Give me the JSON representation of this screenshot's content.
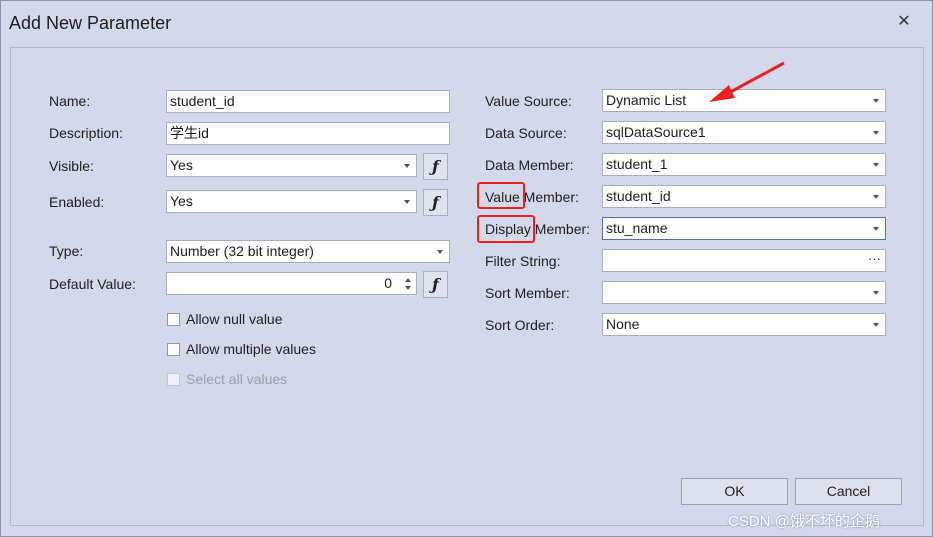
{
  "window": {
    "title": "Add New Parameter",
    "close_symbol": "✕"
  },
  "left": {
    "name_label": "Name:",
    "name_value": "student_id",
    "description_label": "Description:",
    "description_value": "学生id",
    "visible_label": "Visible:",
    "visible_value": "Yes",
    "enabled_label": "Enabled:",
    "enabled_value": "Yes",
    "type_label": "Type:",
    "type_value": "Number (32 bit integer)",
    "default_label": "Default Value:",
    "default_value": "0",
    "fx_symbol": "ƒ",
    "allow_null": {
      "label": "Allow null value",
      "checked": false
    },
    "allow_multiple": {
      "label": "Allow multiple values",
      "checked": false
    },
    "select_all": {
      "label": "Select all values",
      "checked": false,
      "disabled": true
    }
  },
  "right": {
    "value_source_label": "Value Source:",
    "value_source_value": "Dynamic List",
    "data_source_label": "Data Source:",
    "data_source_value": "sqlDataSource1",
    "data_member_label": "Data Member:",
    "data_member_value": "student_1",
    "value_member_label_a": "Value",
    "value_member_label_b": "Member:",
    "value_member_value": "student_id",
    "display_member_label_a": "Display",
    "display_member_label_b": "Member:",
    "display_member_value": "stu_name",
    "filter_string_label": "Filter String:",
    "filter_string_value": "",
    "ellipsis": "···",
    "sort_member_label": "Sort Member:",
    "sort_member_value": "",
    "sort_order_label": "Sort Order:",
    "sort_order_value": "None"
  },
  "buttons": {
    "ok": "OK",
    "cancel": "Cancel"
  },
  "watermark": "CSDN @饿不坏的企鹅",
  "colors": {
    "annotation_red": "#e8231f",
    "background": "#d3d9ea"
  }
}
